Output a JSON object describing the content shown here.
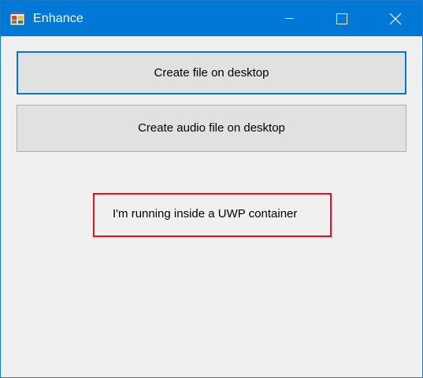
{
  "window": {
    "title": "Enhance",
    "app_icon": "winforms-app-icon",
    "controls": {
      "minimize_icon": "minimize-icon",
      "maximize_icon": "maximize-icon",
      "close_icon": "close-icon"
    }
  },
  "buttons": {
    "create_file_label": "Create file on desktop",
    "create_audio_label": "Create audio file on desktop"
  },
  "status": {
    "text": "I'm running inside a UWP container"
  },
  "colors": {
    "titlebar": "#0078d7",
    "focus_border": "#0078d7",
    "status_border": "#e81123",
    "window_background": "#f0f0f0",
    "button_background": "#e1e1e1"
  }
}
